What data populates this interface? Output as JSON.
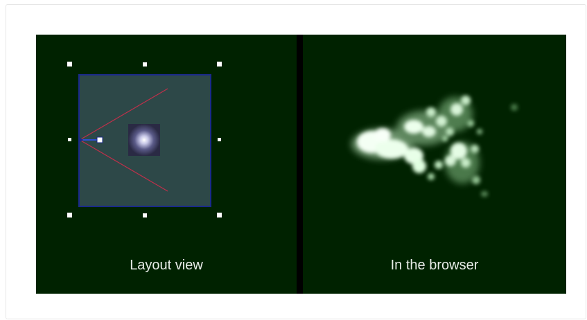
{
  "panels": {
    "layout": {
      "caption": "Layout view"
    },
    "browser": {
      "caption": "In the browser"
    }
  },
  "colors": {
    "panel_bg": "#002200",
    "divider": "#000000",
    "emitter_fill": "#2d4848",
    "emitter_border": "#1a2a8a",
    "spread_lines": "#c0304a",
    "particle_glow": "#e8ffe8"
  },
  "icons": {
    "particle_sprite": "glow-sprite-icon"
  }
}
